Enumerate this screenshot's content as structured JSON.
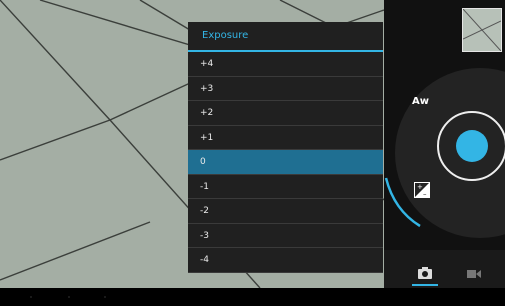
{
  "popup": {
    "title": "Exposure",
    "options": [
      "+4",
      "+3",
      "+2",
      "+1",
      "0",
      "-1",
      "-2",
      "-3",
      "-4"
    ],
    "selected_value": "0"
  },
  "icons": {
    "auto_wb": "Aw"
  },
  "colors": {
    "accent": "#33b5e5",
    "selected_row": "#1f6f92",
    "popup_bg": "#202020"
  }
}
